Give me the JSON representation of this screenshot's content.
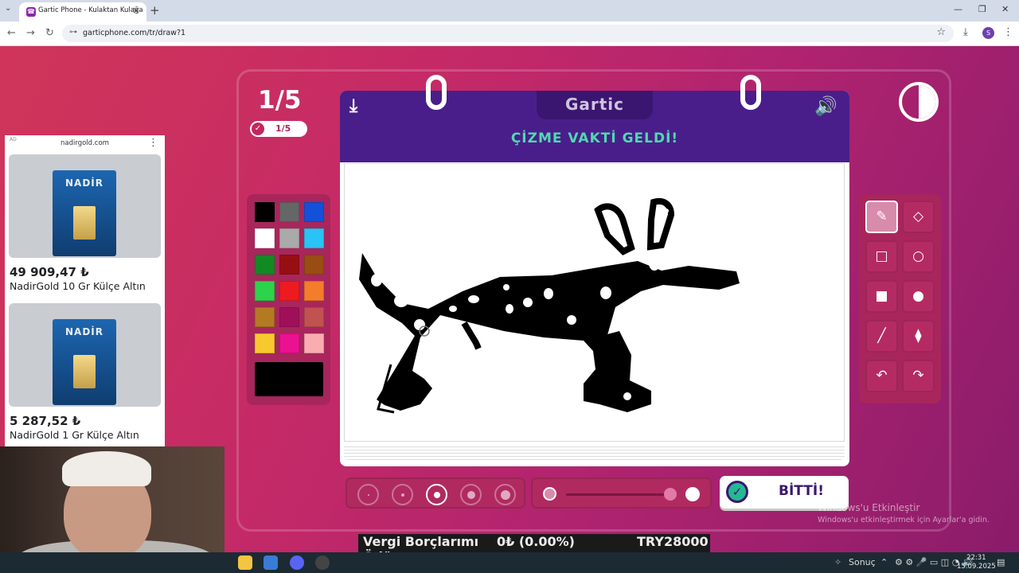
{
  "browser": {
    "tab_title": "Gartic Phone - Kulaktan Kulağa",
    "tab_favicon": "☎",
    "url": "garticphone.com/tr/draw?1",
    "profile_initial": "S"
  },
  "game": {
    "round_big": "1/5",
    "round_pill": "1/5",
    "logo": "Gartic",
    "title": "ÇİZME VAKTİ GELDİ!",
    "done_label": "BİTTİ!",
    "palette": [
      "#000000",
      "#666666",
      "#1351d8",
      "#ffffff",
      "#aaaaaa",
      "#28c4f5",
      "#118a23",
      "#980f13",
      "#994d12",
      "#2bd44a",
      "#ed1b1f",
      "#f37d2a",
      "#b37a21",
      "#a0105a",
      "#c15252",
      "#f8c92e",
      "#ec1190",
      "#f9adb1"
    ],
    "current_color": "#000000",
    "tools": [
      "pencil-icon",
      "eraser-icon",
      "rect-outline-icon",
      "circle-outline-icon",
      "rect-fill-icon",
      "circle-fill-icon",
      "line-icon",
      "bucket-icon",
      "undo-icon",
      "redo-icon"
    ],
    "brush_sizes": 5,
    "brush_selected_index": 2,
    "opacity_percent": 95
  },
  "ad": {
    "tag": "AD",
    "site": "nadirgold.com",
    "brand": "NADİR",
    "products": [
      {
        "price": "49 909,47 ₺",
        "name": "NadirGold 10 Gr Külçe Altın"
      },
      {
        "price": "5 287,52 ₺",
        "name": "NadirGold 1 Gr Külçe Altın"
      }
    ]
  },
  "ticker": {
    "line1": "Vergi Borçlarımı",
    "line2": "Ödüyorum.",
    "value": "0₺ (0.00%)",
    "goal": "TRY28000"
  },
  "watermark": {
    "line1": "Windows'u Etkinleştir",
    "line2": "Windows'u etkinleştirmek için Ayarlar'a gidin."
  },
  "taskbar": {
    "search_label": "Sonuç",
    "time": "22:31",
    "date": "15.09.2025"
  }
}
